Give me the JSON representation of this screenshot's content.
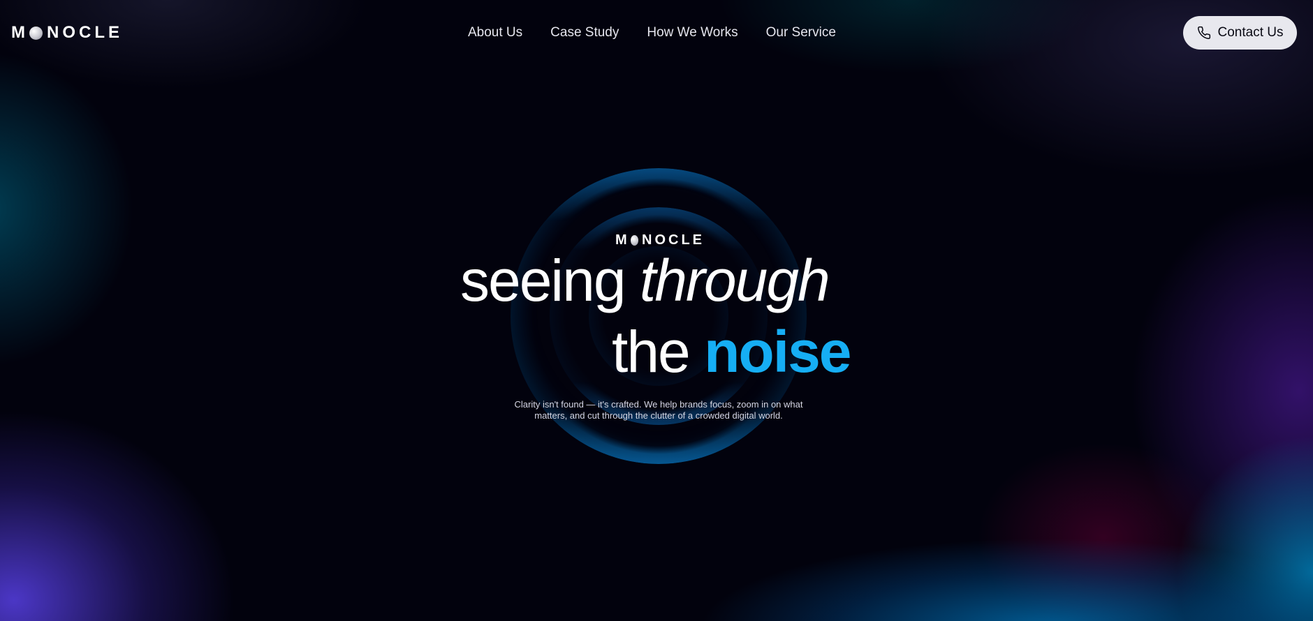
{
  "brand": {
    "name_prefix": "M",
    "name_suffix": "NOCLE"
  },
  "nav": {
    "items": [
      {
        "label": "About Us"
      },
      {
        "label": "Case Study"
      },
      {
        "label": "How We Works"
      },
      {
        "label": "Our Service"
      }
    ]
  },
  "contact": {
    "label": "Contact Us",
    "icon": "phone-icon"
  },
  "hero": {
    "logo_prefix": "M",
    "logo_suffix": "NOCLE",
    "headline_line1_regular": "seeing ",
    "headline_line1_italic": "through",
    "headline_line2_regular": "the ",
    "headline_line2_accent": "noise",
    "subtext": "Clarity isn't found — it's crafted. We help brands focus, zoom in on what matters, and cut through the clutter of a crowded digital world."
  },
  "colors": {
    "background": "#02020d",
    "accent": "#16aef4",
    "button_bg": "#e8e8ee",
    "button_text": "#0a0a14"
  }
}
